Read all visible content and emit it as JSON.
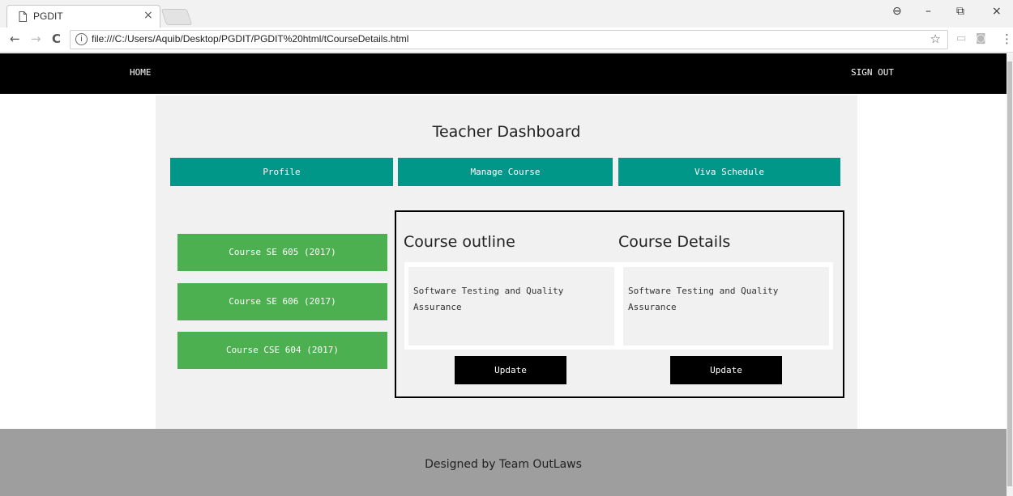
{
  "browser": {
    "tab_title": "PGDIT",
    "tab_close": "×",
    "back": "←",
    "forward": "→",
    "reload": "C",
    "info": "i",
    "url": "file:///C:/Users/Aquib/Desktop/PGDIT/PGDIT%20html/tCourseDetails.html",
    "bookmark": "☆",
    "window_controls": {
      "profile": "⊖",
      "minimize": "–",
      "restore": "⧉",
      "close": "×"
    }
  },
  "header": {
    "home": "HOME",
    "signout": "SIGN OUT"
  },
  "dashboard": {
    "title": "Teacher Dashboard",
    "tabs": [
      "Profile",
      "Manage Course",
      "Viva Schedule"
    ]
  },
  "courses": [
    "Course SE 605 (2017)",
    "Course SE 606 (2017)",
    "Course CSE 604 (2017)"
  ],
  "outline": {
    "heading": "Course outline",
    "text": "Software Testing and Quality Assurance",
    "button": "Update"
  },
  "details": {
    "heading": "Course Details",
    "text": "Software Testing and Quality Assurance",
    "button": "Update"
  },
  "footer": {
    "text": "Designed by Team OutLaws"
  },
  "colors": {
    "teal": "#009688",
    "green": "#4caf50",
    "black": "#000000",
    "panel": "#f1f1f1",
    "footer": "#9e9e9e"
  }
}
